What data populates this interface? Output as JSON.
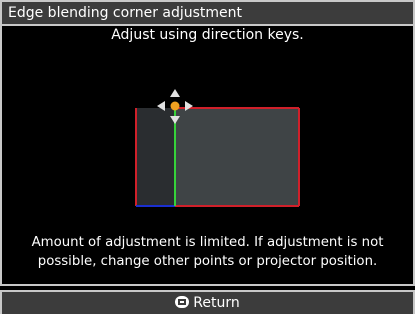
{
  "dialog": {
    "title": "Edge blending corner adjustment",
    "instruction": "Adjust using direction keys.",
    "warning_line1": "Amount of adjustment is limited. If adjustment is not",
    "warning_line2": "possible, change other points or projector position."
  },
  "footer": {
    "return_label": "Return",
    "menu_icon": "menu-button-icon"
  },
  "colors": {
    "title_bg": "#3c3c3c",
    "border": "#c8c8c8",
    "screen_fill": "#3f4446",
    "screen_overlap_fill": "#2a2d30",
    "edge_red": "#d0202a",
    "edge_blue": "#1a2fd0",
    "blend_line_green": "#36d23a",
    "cursor_orange": "#f0a020",
    "arrow": "#e0e0e0"
  },
  "icons": {
    "direction_cursor": "four-way-direction-cursor-icon"
  }
}
